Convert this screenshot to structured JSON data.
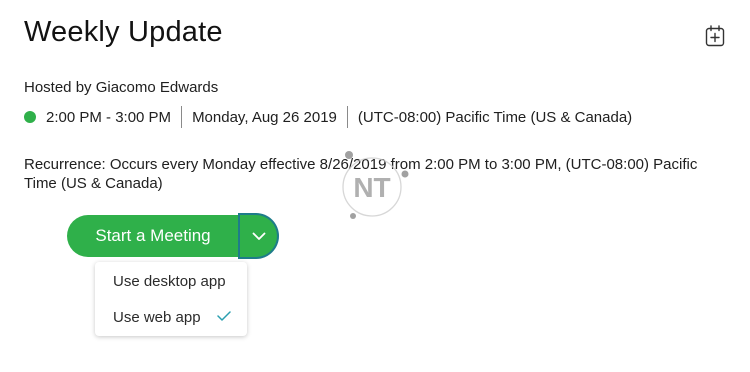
{
  "meeting": {
    "title": "Weekly Update",
    "host": "Hosted by Giacomo Edwards",
    "time_range": "2:00 PM - 3:00 PM",
    "date": "Monday, Aug 26 2019",
    "timezone": "(UTC-08:00) Pacific Time (US & Canada)",
    "status_color": "#2fb04a",
    "recurrence": "Recurrence: Occurs every Monday effective 8/26/2019 from 2:00 PM to 3:00 PM, (UTC-08:00) Pacific Time (US & Canada)"
  },
  "header": {
    "add_to_calendar_icon": "calendar-add-icon"
  },
  "actions": {
    "start_label": "Start a Meeting",
    "toggle_icon": "chevron-down-icon",
    "accent_color": "#2fb04a"
  },
  "dropdown": {
    "items": [
      {
        "label": "Use desktop app",
        "selected": false
      },
      {
        "label": "Use web app",
        "selected": true,
        "icon": "check-icon"
      }
    ]
  },
  "watermark": {
    "text": "NT"
  }
}
